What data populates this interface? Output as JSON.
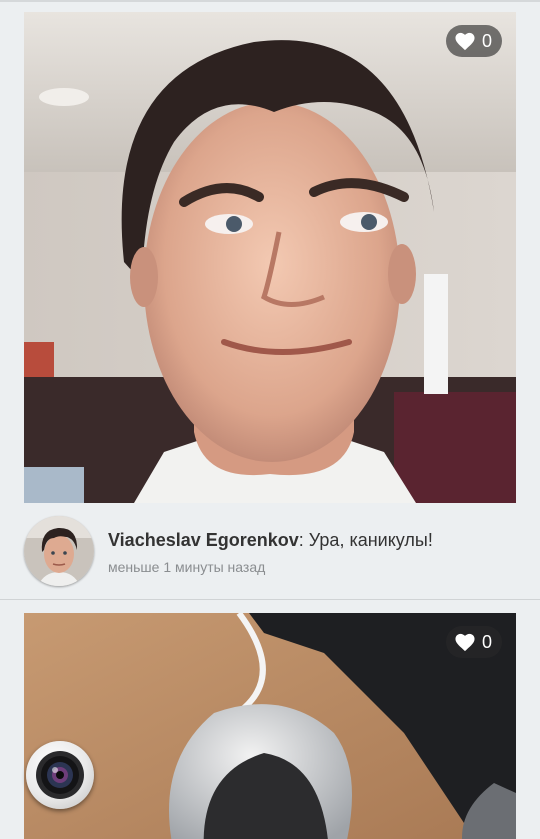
{
  "posts": [
    {
      "author": "Viacheslav Egorenkov",
      "separator": ":",
      "text": " Ура, каникулы!",
      "time": "меньше 1 минуты назад",
      "likes": "0",
      "icon": "heart-icon"
    },
    {
      "likes": "0",
      "icon": "heart-icon"
    }
  ],
  "fab": {
    "icon": "camera-lens-icon"
  },
  "colors": {
    "background": "#eceff1",
    "text": "#333333",
    "timestamp": "#8a8d90"
  }
}
